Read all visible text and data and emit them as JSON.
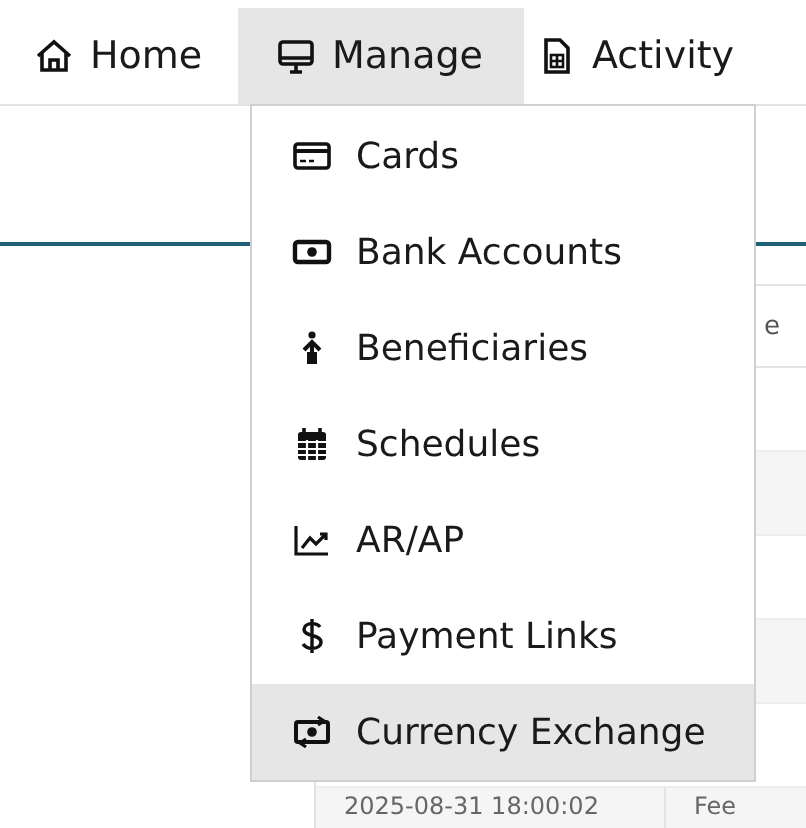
{
  "nav": [
    {
      "label": "Home",
      "kind": "home",
      "selected": false
    },
    {
      "label": "Manage",
      "kind": "monitor",
      "selected": true
    },
    {
      "label": "Activity",
      "kind": "sheet",
      "selected": false
    }
  ],
  "menu": [
    {
      "label": "Cards",
      "kind": "card",
      "selected": false
    },
    {
      "label": "Bank Accounts",
      "kind": "cash",
      "selected": false
    },
    {
      "label": "Beneficiaries",
      "kind": "person",
      "selected": false
    },
    {
      "label": "Schedules",
      "kind": "calendar",
      "selected": false
    },
    {
      "label": "AR/AP",
      "kind": "chart",
      "selected": false
    },
    {
      "label": "Payment Links",
      "kind": "dollar",
      "selected": false
    },
    {
      "label": "Currency Exchange",
      "kind": "exchange",
      "selected": true
    }
  ],
  "table": {
    "columns": [
      "e"
    ],
    "rows": [
      {
        "cells": []
      },
      {
        "cells": []
      },
      {
        "cells": []
      },
      {
        "cells": []
      },
      {
        "cells": []
      },
      {
        "cells": [
          "2025-08-31 18:00:02",
          "Fee"
        ]
      }
    ]
  }
}
